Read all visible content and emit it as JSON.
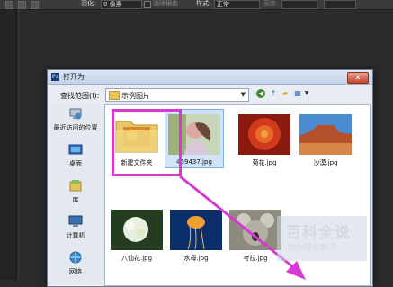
{
  "options_bar": {
    "feather_label": "羽化:",
    "feather_value": "0 像素",
    "antialias_label": "消除锯齿",
    "style_label": "样式:",
    "style_value": "正常",
    "width_label": "宽度:"
  },
  "dialog": {
    "title": "打开为",
    "close_glyph": "✕",
    "lookin_label": "查找范围(I):",
    "lookin_value": "示例图片",
    "lookin_arrow": "▼"
  },
  "places": [
    {
      "label": "最近访问的位置",
      "icon": "recent-places-icon"
    },
    {
      "label": "桌面",
      "icon": "desktop-icon"
    },
    {
      "label": "库",
      "icon": "library-icon"
    },
    {
      "label": "计算机",
      "icon": "computer-icon"
    },
    {
      "label": "网络",
      "icon": "network-icon"
    }
  ],
  "files": [
    {
      "name": "新建文件夹",
      "kind": "folder"
    },
    {
      "name": "459437.jpg",
      "kind": "image",
      "selected": true
    },
    {
      "name": "菊花.jpg",
      "kind": "image"
    },
    {
      "name": "沙漠.jpg",
      "kind": "image"
    },
    {
      "name": "八仙花.jpg",
      "kind": "image"
    },
    {
      "name": "水母.jpg",
      "kind": "image"
    },
    {
      "name": "考拉.jpg",
      "kind": "image"
    }
  ],
  "watermark": {
    "title": "百科全说",
    "subtitle": "助你轻松解决"
  },
  "colors": {
    "highlight": "#d63ad0",
    "arrow": "#d63ad0"
  }
}
